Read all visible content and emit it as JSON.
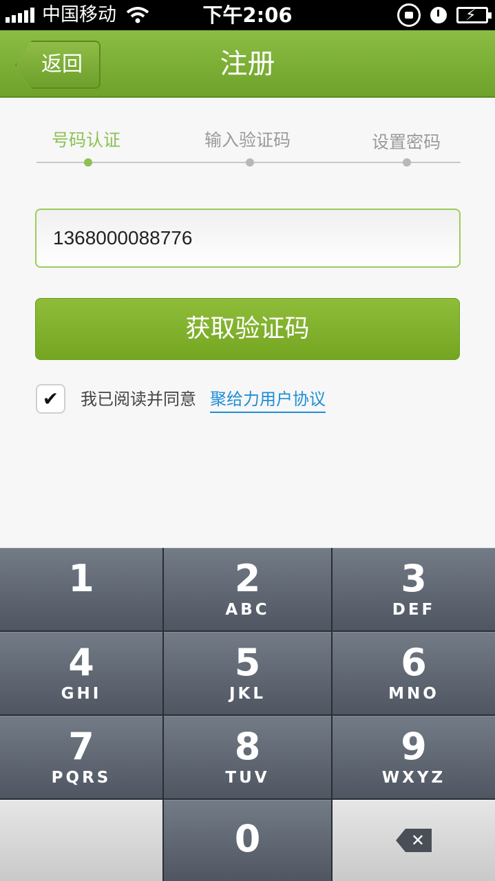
{
  "status_bar": {
    "carrier": "中国移动",
    "time": "下午2:06",
    "icons": [
      "signal-icon",
      "wifi-icon",
      "rotation-lock-icon",
      "alarm-icon",
      "battery-charging-icon"
    ]
  },
  "nav": {
    "back_label": "返回",
    "title": "注册"
  },
  "steps": [
    {
      "label": "号码认证",
      "active": true
    },
    {
      "label": "输入验证码",
      "active": false
    },
    {
      "label": "设置密码",
      "active": false
    }
  ],
  "phone_field": {
    "value": "1368000088776"
  },
  "get_code_button": "获取验证码",
  "agreement": {
    "checked": true,
    "check_glyph": "✔",
    "text": "我已阅读并同意",
    "link": "聚给力用户协议"
  },
  "keypad": {
    "keys": [
      {
        "digit": "1",
        "letters": ""
      },
      {
        "digit": "2",
        "letters": "ABC"
      },
      {
        "digit": "3",
        "letters": "DEF"
      },
      {
        "digit": "4",
        "letters": "GHI"
      },
      {
        "digit": "5",
        "letters": "JKL"
      },
      {
        "digit": "6",
        "letters": "MNO"
      },
      {
        "digit": "7",
        "letters": "PQRS"
      },
      {
        "digit": "8",
        "letters": "TUV"
      },
      {
        "digit": "9",
        "letters": "WXYZ"
      },
      {
        "digit": "0",
        "letters": ""
      }
    ],
    "backspace_glyph": "✕"
  },
  "colors": {
    "accent_green": "#7aab2a",
    "active_step": "#8cc152",
    "link_blue": "#1e8ed7"
  }
}
